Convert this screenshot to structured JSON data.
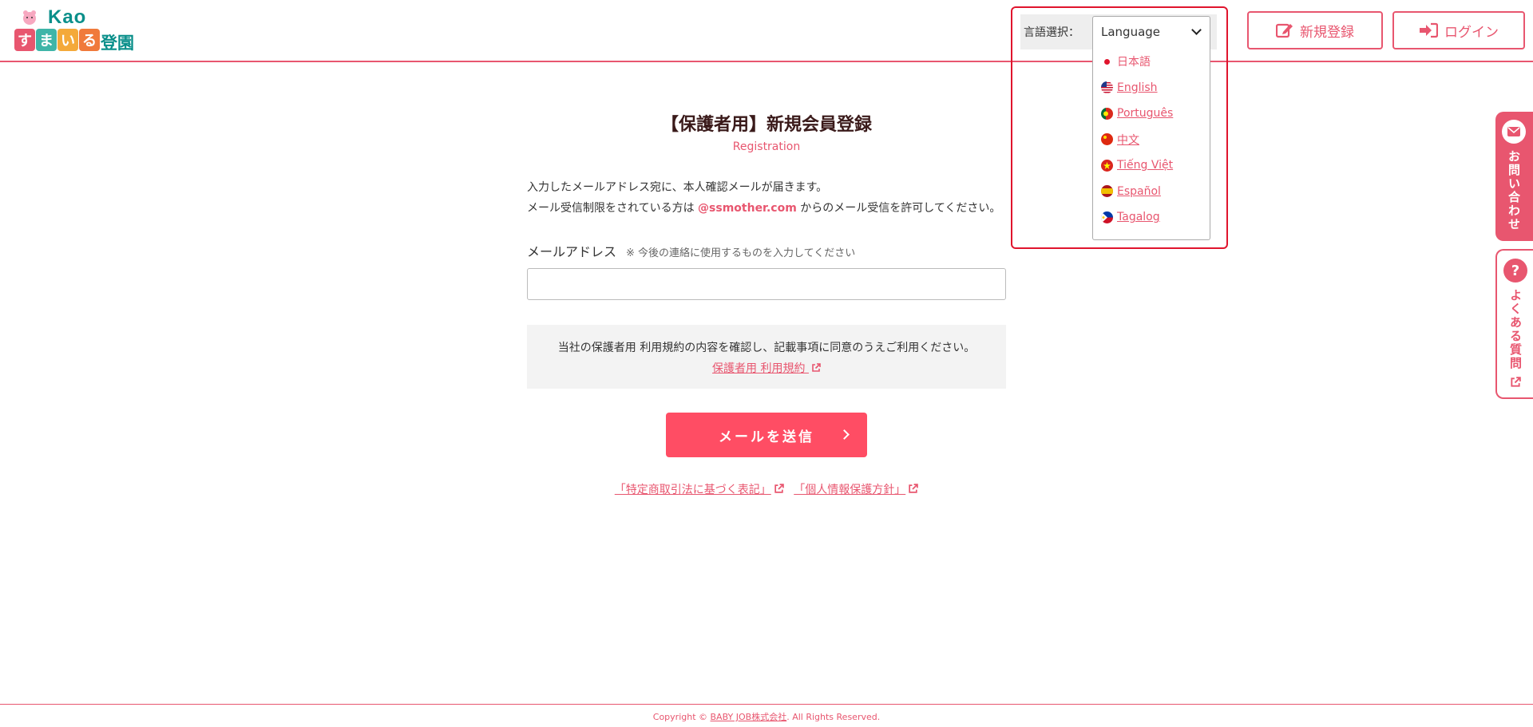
{
  "header": {
    "logo": {
      "brand": "Kao",
      "blocks": [
        "す",
        "ま",
        "い",
        "る"
      ],
      "suffix": "登園"
    },
    "language": {
      "label": "言語選択：",
      "selected": "Language",
      "options": [
        {
          "label": "日本語",
          "flag": "jp"
        },
        {
          "label": "English",
          "flag": "us"
        },
        {
          "label": "Português",
          "flag": "pt"
        },
        {
          "label": "中文",
          "flag": "cn"
        },
        {
          "label": "Tiếng Việt",
          "flag": "vn"
        },
        {
          "label": "Español",
          "flag": "es"
        },
        {
          "label": "Tagalog",
          "flag": "ph"
        }
      ]
    },
    "register_label": "新規登録",
    "login_label": "ログイン"
  },
  "main": {
    "title": "【保護者用】新規会員登録",
    "subtitle": "Registration",
    "desc_line1": "入力したメールアドレス宛に、本人確認メールが届きます。",
    "desc_line2_pre": "メール受信制限をされている方は ",
    "desc_email": "@ssmother.com",
    "desc_line2_post": " からのメール受信を許可してください。",
    "email_label": "メールアドレス",
    "email_note": "※ 今後の連絡に使用するものを入力してください",
    "email_value": "",
    "terms_text": "当社の保護者用 利用規約の内容を確認し、記載事項に同意のうえご利用ください。",
    "terms_link": "保護者用 利用規約",
    "send_label": "メールを送信",
    "link_tokusho": "「特定商取引法に基づく表記」",
    "link_privacy": "「個人情報保護方針」"
  },
  "side": {
    "contact_label": "お問い合わせ",
    "faq_label": "よくある質問"
  },
  "footer": {
    "copyright_pre": "Copyright © ",
    "company": "BABY JOB株式会社",
    "copyright_post": ". All Rights Reserved."
  },
  "colors": {
    "accent": "#e8566f",
    "button": "#ff4d64",
    "highlight_border": "#e0142d"
  }
}
